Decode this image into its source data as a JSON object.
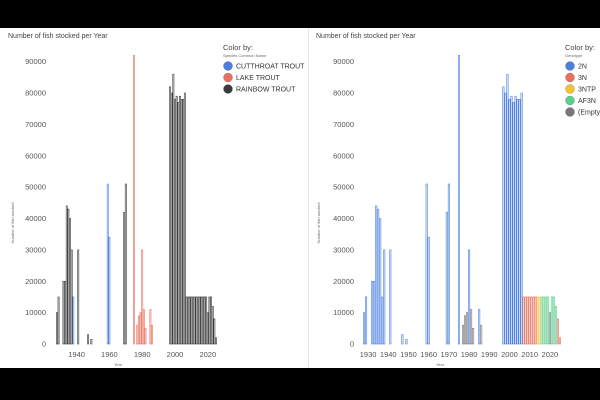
{
  "chart_data": [
    {
      "type": "bar",
      "title": "Number of fish stocked per Year",
      "xlabel": "Year",
      "ylabel": "Number of fish stocked",
      "ylim": [
        0,
        95000
      ],
      "xlim": [
        1925,
        2025
      ],
      "yticks": [
        0,
        10000,
        20000,
        30000,
        40000,
        50000,
        60000,
        70000,
        80000,
        90000
      ],
      "xticks": [
        1940,
        1960,
        1980,
        2000,
        2020
      ],
      "grid": false,
      "legend": {
        "title": "Color by:",
        "subtitle": "Species Common Name",
        "placement": "top-right",
        "entries": [
          {
            "label": "CUTTHROAT TROUT",
            "color": "#4a7fe0"
          },
          {
            "label": "LAKE TROUT",
            "color": "#e8705e"
          },
          {
            "label": "RAINBOW TROUT",
            "color": "#3a3a3a"
          }
        ]
      },
      "series": [
        {
          "color": "#4a7fe0",
          "points": [
            [
              1938,
              15000
            ],
            [
              1959,
              51000
            ],
            [
              1960,
              34000
            ]
          ]
        },
        {
          "color": "#e8705e",
          "points": [
            [
              1975,
              92000
            ],
            [
              1977,
              6000
            ],
            [
              1978,
              9000
            ],
            [
              1979,
              10000
            ],
            [
              1980,
              30000
            ],
            [
              1981,
              11000
            ],
            [
              1982,
              5000
            ],
            [
              1985,
              11000
            ],
            [
              1986,
              6000
            ]
          ]
        },
        {
          "color": "#3a3a3a",
          "points": [
            [
              1928,
              10000
            ],
            [
              1929,
              15000
            ],
            [
              1932,
              20000
            ],
            [
              1933,
              20000
            ],
            [
              1934,
              44000
            ],
            [
              1935,
              43000
            ],
            [
              1936,
              40000
            ],
            [
              1937,
              30000
            ],
            [
              1941,
              30000
            ],
            [
              1947,
              3000
            ],
            [
              1949,
              1500
            ],
            [
              1969,
              42000
            ],
            [
              1970,
              51000
            ],
            [
              1997,
              82000
            ],
            [
              1998,
              80000
            ],
            [
              1999,
              86000
            ],
            [
              2000,
              78000
            ],
            [
              2001,
              79000
            ],
            [
              2002,
              77000
            ],
            [
              2003,
              79000
            ],
            [
              2004,
              78000
            ],
            [
              2005,
              78000
            ],
            [
              2006,
              80000
            ],
            [
              2007,
              15000
            ],
            [
              2008,
              15000
            ],
            [
              2009,
              15000
            ],
            [
              2010,
              15000
            ],
            [
              2011,
              15000
            ],
            [
              2012,
              15000
            ],
            [
              2013,
              15000
            ],
            [
              2014,
              15000
            ],
            [
              2015,
              15000
            ],
            [
              2016,
              15000
            ],
            [
              2017,
              15000
            ],
            [
              2018,
              15000
            ],
            [
              2019,
              15000
            ],
            [
              2020,
              10000
            ],
            [
              2021,
              15000
            ],
            [
              2022,
              15000
            ],
            [
              2023,
              12000
            ],
            [
              2024,
              8000
            ],
            [
              2025,
              2000
            ]
          ]
        }
      ]
    },
    {
      "type": "bar",
      "title": "Number of fish stocked per Year",
      "xlabel": "Year",
      "ylabel": "Number of fish stocked",
      "ylim": [
        0,
        95000
      ],
      "xlim": [
        1926,
        2026
      ],
      "yticks": [
        0,
        10000,
        20000,
        30000,
        40000,
        50000,
        60000,
        70000,
        80000,
        90000
      ],
      "xticks": [
        1930,
        1940,
        1950,
        1960,
        1970,
        1980,
        1990,
        2000,
        2010,
        2020
      ],
      "grid": false,
      "legend": {
        "title": "Color by:",
        "subtitle": "Genotype",
        "placement": "top-right",
        "entries": [
          {
            "label": "2N",
            "color": "#4a7fe0"
          },
          {
            "label": "3N",
            "color": "#e8705e"
          },
          {
            "label": "3NTP",
            "color": "#f2c230"
          },
          {
            "label": "AF3N",
            "color": "#5bcf8c"
          },
          {
            "label": "(Empty)",
            "color": "#777777"
          }
        ]
      },
      "series": [
        {
          "color": "#4a7fe0",
          "points": [
            [
              1928,
              10000
            ],
            [
              1929,
              15000
            ],
            [
              1932,
              20000
            ],
            [
              1933,
              20000
            ],
            [
              1934,
              44000
            ],
            [
              1935,
              43000
            ],
            [
              1936,
              40000
            ],
            [
              1937,
              15000
            ],
            [
              1938,
              30000
            ],
            [
              1941,
              30000
            ],
            [
              1947,
              3000
            ],
            [
              1949,
              1500
            ],
            [
              1959,
              51000
            ],
            [
              1960,
              34000
            ],
            [
              1969,
              42000
            ],
            [
              1970,
              51000
            ],
            [
              1975,
              92000
            ],
            [
              1980,
              30000
            ],
            [
              1985,
              11000
            ],
            [
              1997,
              82000
            ],
            [
              1998,
              80000
            ],
            [
              1999,
              86000
            ],
            [
              2000,
              78000
            ],
            [
              2001,
              79000
            ],
            [
              2002,
              77000
            ],
            [
              2003,
              79000
            ],
            [
              2004,
              78000
            ],
            [
              2005,
              78000
            ],
            [
              2006,
              80000
            ]
          ]
        },
        {
          "color": "#e8705e",
          "points": [
            [
              2007,
              15000
            ],
            [
              2008,
              15000
            ],
            [
              2009,
              15000
            ],
            [
              2010,
              15000
            ],
            [
              2011,
              15000
            ],
            [
              2012,
              15000
            ],
            [
              2013,
              15000
            ],
            [
              2024,
              8000
            ],
            [
              2025,
              2000
            ]
          ]
        },
        {
          "color": "#f2c230",
          "points": [
            [
              2014,
              15000
            ],
            [
              2015,
              15000
            ]
          ]
        },
        {
          "color": "#5bcf8c",
          "points": [
            [
              2016,
              15000
            ],
            [
              2017,
              15000
            ],
            [
              2018,
              15000
            ],
            [
              2019,
              15000
            ],
            [
              2021,
              15000
            ],
            [
              2022,
              15000
            ],
            [
              2023,
              12000
            ]
          ]
        },
        {
          "color": "#777777",
          "points": [
            [
              1977,
              6000
            ],
            [
              1978,
              9000
            ],
            [
              1979,
              10000
            ],
            [
              1981,
              11000
            ],
            [
              1982,
              5000
            ],
            [
              1986,
              6000
            ],
            [
              2020,
              10000
            ]
          ]
        }
      ]
    }
  ]
}
